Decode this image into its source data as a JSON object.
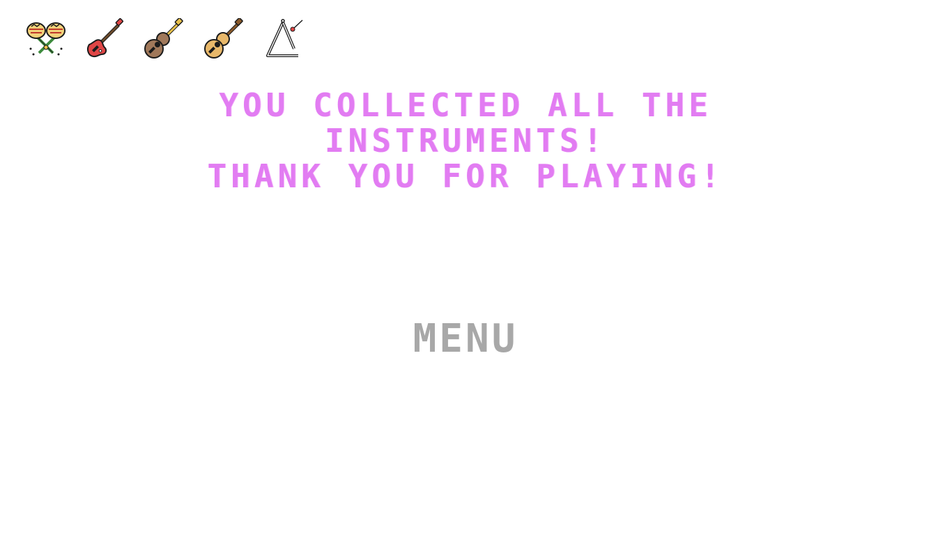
{
  "inventory": {
    "items": [
      {
        "icon": "maracas-icon"
      },
      {
        "icon": "electric-guitar-icon"
      },
      {
        "icon": "ukulele-icon"
      },
      {
        "icon": "acoustic-guitar-icon"
      },
      {
        "icon": "triangle-icon"
      }
    ]
  },
  "message": {
    "line1": "YOU COLLECTED ALL THE",
    "line2": "INSTRUMENTS!",
    "line3": "THANK YOU FOR PLAYING!"
  },
  "menu": {
    "label": "MENU"
  },
  "colors": {
    "message": "#e27cf2",
    "menu": "#a8a8a8",
    "background": "#ffffff"
  }
}
